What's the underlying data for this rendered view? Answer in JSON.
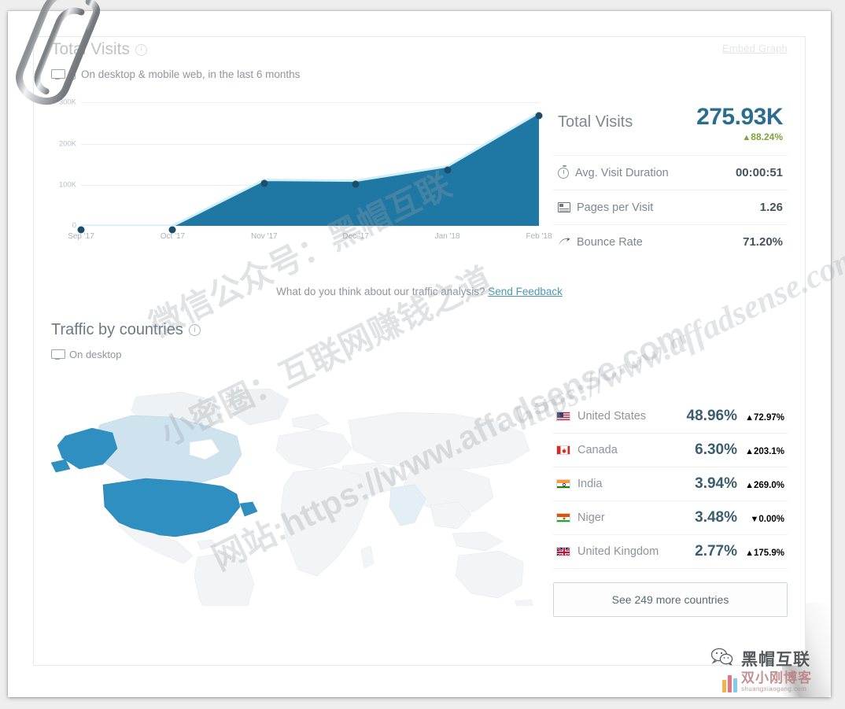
{
  "visits": {
    "title": "Total Visits",
    "embed_link": "Embed Graph",
    "subtitle": "On desktop & mobile web, in the last 6 months",
    "hero_label": "Total Visits",
    "hero_value": "275.93K",
    "hero_delta": "88.24%",
    "hero_delta_dir": "up",
    "rows": [
      {
        "label": "Avg. Visit Duration",
        "value": "00:00:51",
        "icon": "clock-icon"
      },
      {
        "label": "Pages per Visit",
        "value": "1.26",
        "icon": "pages-icon"
      },
      {
        "label": "Bounce Rate",
        "value": "71.20%",
        "icon": "bounce-arrow-icon"
      }
    ]
  },
  "feedback": {
    "question": "What do you think about our traffic analysis?",
    "link": "Send Feedback"
  },
  "countries": {
    "title": "Traffic by countries",
    "subtitle": "On desktop",
    "rows": [
      {
        "name": "United States",
        "share": "48.96%",
        "delta": "72.97%",
        "dir": "up"
      },
      {
        "name": "Canada",
        "share": "6.30%",
        "delta": "203.1%",
        "dir": "up"
      },
      {
        "name": "India",
        "share": "3.94%",
        "delta": "269.0%",
        "dir": "up"
      },
      {
        "name": "Niger",
        "share": "3.48%",
        "delta": "0.00%",
        "dir": "down"
      },
      {
        "name": "United Kingdom",
        "share": "2.77%",
        "delta": "175.9%",
        "dir": "up"
      }
    ],
    "see_more": "See 249 more countries"
  },
  "watermarks": {
    "cn1": "微信公众号：黑帽互联",
    "cn2": "小密圈：互联网赚钱之道",
    "cn3": "网站:https://www.affadsense.com",
    "url": "https://www.affadsense.com"
  },
  "brand": {
    "name": "黑帽互联",
    "logo_cn": "双小刚博客",
    "logo_en": "shuangxiaogang.com"
  },
  "colors": {
    "area_fill": "#1f77a4",
    "line": "#cfeef8",
    "marker": "#1d4e68",
    "value_blue": "#2b6d8f",
    "up_green": "#7fa33b",
    "down_red": "#d8616a",
    "map_high": "#2f8fc0",
    "map_mid": "#cfe3ef",
    "map_low": "#f1f3f4"
  },
  "chart_data": {
    "type": "area",
    "title": "Total Visits",
    "subtitle": "On desktop & mobile web, in the last 6 months",
    "categories": [
      "Sep '17",
      "Oct '17",
      "Nov '17",
      "Dec '17",
      "Jan '18",
      "Feb '18"
    ],
    "values": [
      0,
      0,
      112000,
      110000,
      145000,
      275930
    ],
    "xlabel": "",
    "ylabel": "",
    "ylim": [
      0,
      320000
    ],
    "yticks": [
      0,
      100000,
      200000,
      300000
    ],
    "ytick_labels": [
      "0",
      "100K",
      "200K",
      "300K"
    ],
    "grid": true,
    "legend": false
  }
}
